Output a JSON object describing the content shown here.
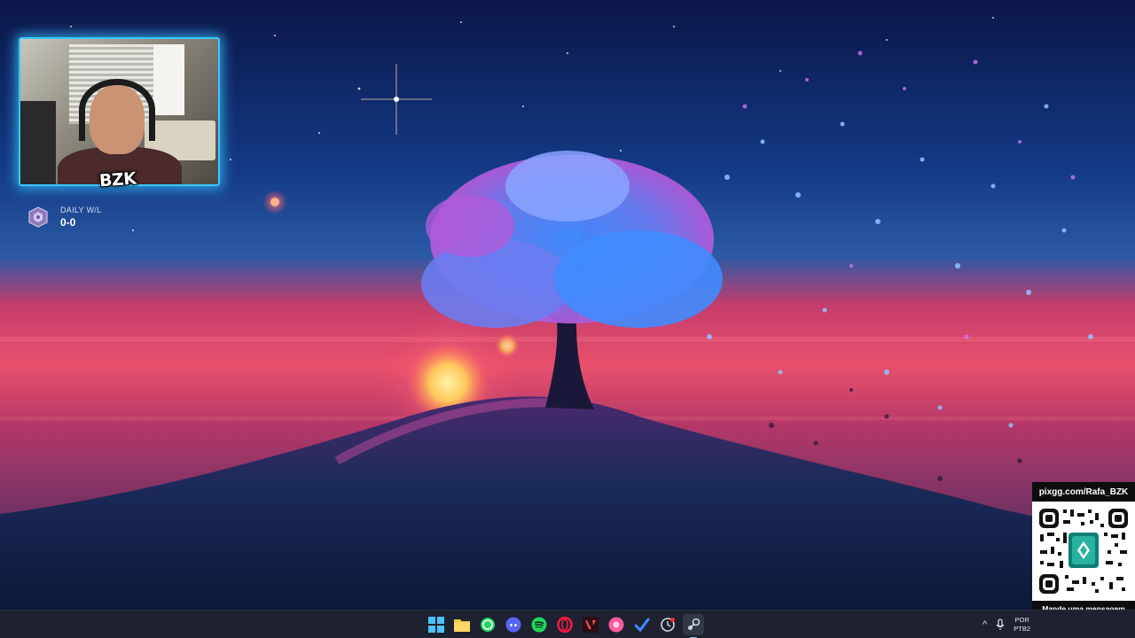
{
  "overlay": {
    "webcam_tag": "BZK",
    "daily_wl": {
      "label": "DAILY W/L",
      "value": "0-0"
    }
  },
  "pix": {
    "url": "pixgg.com/Rafa_BZK",
    "message": "Mande uma mensagem personalizada com personagens!"
  },
  "taskbar": {
    "apps": [
      {
        "name": "start",
        "icon": "windows-icon"
      },
      {
        "name": "file-explorer",
        "icon": "folder-icon"
      },
      {
        "name": "whatsapp",
        "icon": "whatsapp-icon"
      },
      {
        "name": "discord",
        "icon": "discord-icon"
      },
      {
        "name": "spotify",
        "icon": "spotify-icon"
      },
      {
        "name": "opera-gx",
        "icon": "opera-icon"
      },
      {
        "name": "valorant",
        "icon": "valorant-icon"
      },
      {
        "name": "pixel-app",
        "icon": "pink-circle-icon"
      },
      {
        "name": "todo",
        "icon": "check-icon"
      },
      {
        "name": "clock-app",
        "icon": "clock-icon"
      },
      {
        "name": "steam",
        "icon": "steam-icon"
      }
    ],
    "tray": {
      "chevron": "^",
      "lang_line1": "POR",
      "lang_line2": "PTB2"
    }
  },
  "colors": {
    "webcam_border": "#37c8ff",
    "taskbar_bg": "#1e2130",
    "sky_top": "#0c1a4e",
    "sunset": "#e0456a",
    "tree_blossom": "#5aa8ff"
  }
}
